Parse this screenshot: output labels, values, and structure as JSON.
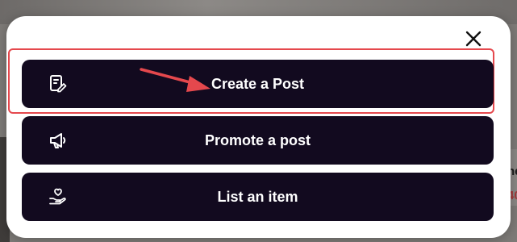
{
  "modal": {
    "close_label": "×",
    "actions": [
      {
        "label": "Create a Post",
        "icon": "edit-note-icon"
      },
      {
        "label": "Promote a post",
        "icon": "megaphone-icon"
      },
      {
        "label": "List an item",
        "icon": "hand-heart-icon"
      }
    ]
  },
  "background": {
    "right_text": "ne",
    "right_price": "40"
  },
  "colors": {
    "button_bg": "#120a1f",
    "highlight": "#e5484d",
    "modal_bg": "#ffffff"
  }
}
